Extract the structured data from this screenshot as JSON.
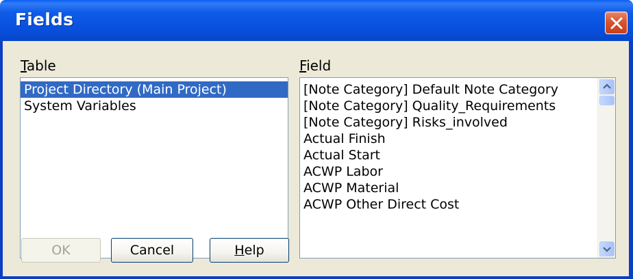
{
  "window": {
    "title": "Fields"
  },
  "icons": {
    "close": "close-icon",
    "scroll_up": "scroll-up-arrow-icon",
    "scroll_down": "scroll-down-arrow-icon"
  },
  "table_panel": {
    "label_accel": "T",
    "label_rest": "able",
    "items": [
      "Project Directory (Main Project)",
      "System Variables"
    ]
  },
  "field_panel": {
    "label_accel": "F",
    "label_rest": "ield",
    "items": [
      "[Note Category] Default Note Category",
      "[Note Category] Quality_Requirements",
      "[Note Category] Risks_involved",
      "Actual Finish",
      "Actual Start",
      "ACWP Labor",
      "ACWP Material",
      "ACWP Other Direct Cost"
    ]
  },
  "buttons": {
    "ok": "OK",
    "cancel": "Cancel",
    "help_accel": "H",
    "help_rest": "elp"
  },
  "colors": {
    "titlebar": "#0850de",
    "selection": "#316ac5",
    "dialog_bg": "#ece9d8"
  }
}
